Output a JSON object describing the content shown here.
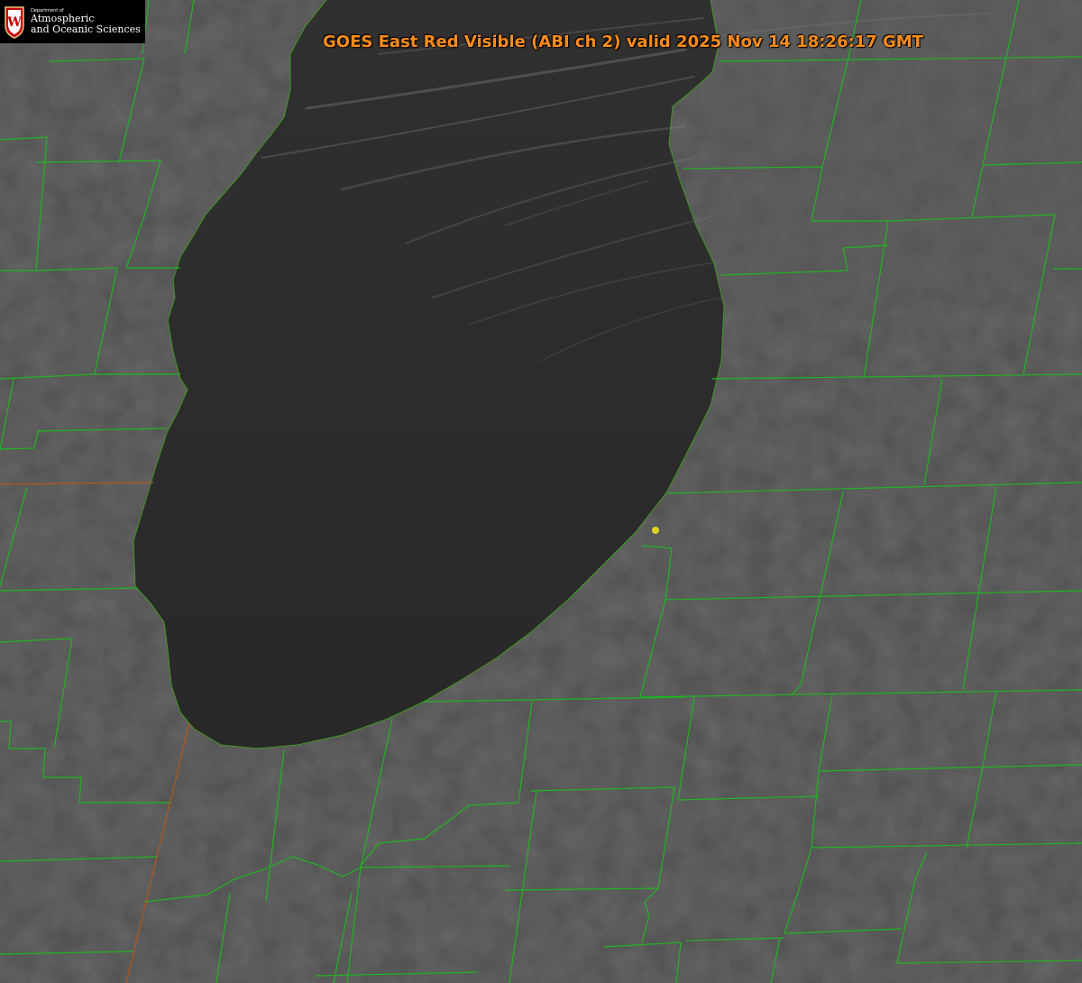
{
  "logo": {
    "seal_letter": "W",
    "dept_label": "Department of",
    "line1": "Atmospheric",
    "line2": "and Oceanic Sciences"
  },
  "title": "GOES East Red Visible (ABI ch 2) valid 2025 Nov 14 18:26:17 GMT",
  "colors": {
    "land": "#4f4f4f",
    "lake": "#2a2a2a",
    "county_lines": "#1fb51f",
    "state_lines": "#b8551a",
    "shoreline_dots": "#e02020",
    "title_text": "#ff8c1a",
    "point_marker": "#e0d21c",
    "logo_seal": "#c5050c",
    "logo_text": "#ffffff"
  },
  "markers": [
    {
      "name": "station-point",
      "icon": "yellow-dot"
    }
  ]
}
